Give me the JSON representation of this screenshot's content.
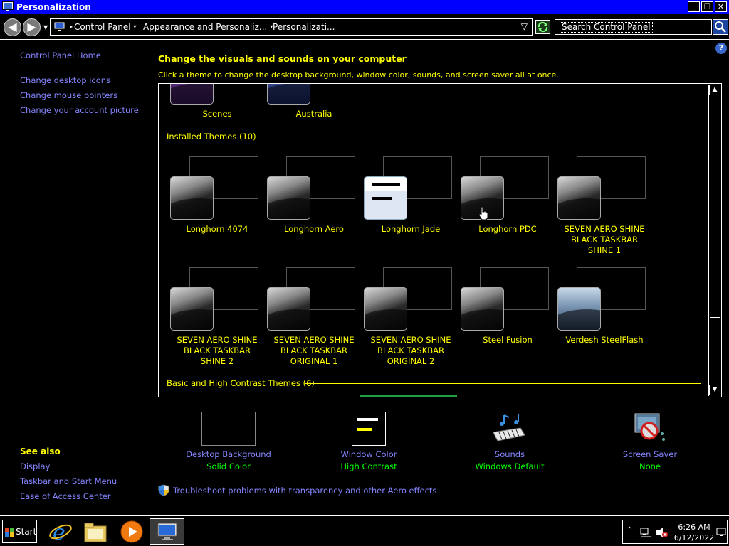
{
  "window": {
    "title": "Personalization",
    "minimize": "_",
    "maximize": "❐",
    "close": "✕"
  },
  "address_bar": {
    "crumbs": [
      "Control Panel",
      "Appearance and Personaliz...",
      "Personalizati..."
    ],
    "search_placeholder": "Search Control Panel"
  },
  "left_pane": {
    "home": "Control Panel Home",
    "links": [
      "Change desktop icons",
      "Change mouse pointers",
      "Change your account picture"
    ],
    "see_also_title": "See also",
    "see_also": [
      "Display",
      "Taskbar and Start Menu",
      "Ease of Access Center"
    ]
  },
  "main": {
    "heading": "Change the visuals and sounds on your computer",
    "subheading": "Click a theme to change the desktop background, window color, sounds, and screen saver all at once.",
    "top_themes": [
      "Scenes",
      "Australia"
    ],
    "installed_label": "Installed Themes (10)",
    "installed_themes": [
      [
        "Longhorn 4074"
      ],
      [
        "Longhorn Aero"
      ],
      [
        "Longhorn Jade"
      ],
      [
        "Longhorn PDC"
      ],
      [
        "SEVEN AERO SHINE",
        "BLACK TASKBAR",
        "SHINE 1"
      ],
      [
        "SEVEN AERO SHINE",
        "BLACK TASKBAR",
        "SHINE 2"
      ],
      [
        "SEVEN AERO SHINE",
        "BLACK TASKBAR",
        "ORIGINAL 1"
      ],
      [
        "SEVEN AERO SHINE",
        "BLACK TASKBAR",
        "ORIGINAL 2"
      ],
      [
        "Steel Fusion"
      ],
      [
        "Verdesh SteelFlash"
      ]
    ],
    "basic_label": "Basic and High Contrast Themes (6)"
  },
  "bottom": {
    "desktop_background": {
      "label": "Desktop Background",
      "value": "Solid Color"
    },
    "window_color": {
      "label": "Window Color",
      "value": "High Contrast"
    },
    "sounds": {
      "label": "Sounds",
      "value": "Windows Default"
    },
    "screen_saver": {
      "label": "Screen Saver",
      "value": "None"
    },
    "troubleshoot": "Troubleshoot problems with transparency and other Aero effects"
  },
  "taskbar": {
    "start": "Start",
    "time": "6:26 AM",
    "date": "6/12/2022"
  },
  "colors": {
    "title_bar": "#0000ff",
    "heading_text": "#ffff00",
    "link_text": "#8585ff",
    "value_text": "#00ff00"
  }
}
